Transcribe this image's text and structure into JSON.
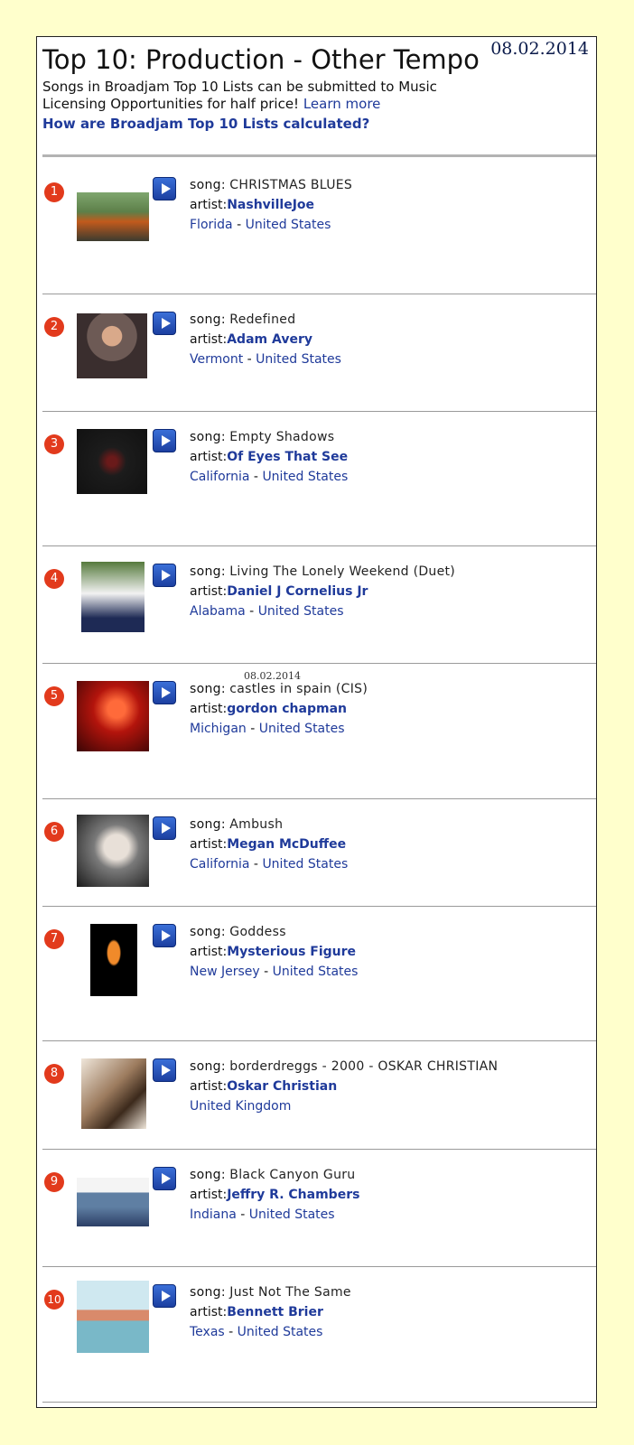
{
  "date": "08.02.2014",
  "header": {
    "title": "Top 10: Production - Other Tempo",
    "subtitle": "Songs in Broadjam Top 10 Lists can be submitted to Music Licensing Opportunities for half price!",
    "learn_more": "Learn more",
    "how_link": "How are Broadjam Top 10 Lists calculated?"
  },
  "labels": {
    "song": "song:",
    "artist": "artist:",
    "sep": " - "
  },
  "accent_color": "#e23a1c",
  "link_color": "#1f3a9a",
  "entries": [
    {
      "rank": "1",
      "song": "CHRISTMAS BLUES",
      "artist": "NashvilleJoe",
      "region": "Florida",
      "country": "United States",
      "thumb": "tractor-photo"
    },
    {
      "rank": "2",
      "song": "Redefined",
      "artist": "Adam Avery",
      "region": "Vermont",
      "country": "United States",
      "thumb": "man-portrait"
    },
    {
      "rank": "3",
      "song": "Empty Shadows",
      "artist": "Of Eyes That See",
      "region": "California",
      "country": "United States",
      "thumb": "album-cover-dark"
    },
    {
      "rank": "4",
      "song": "Living The Lonely Weekend (Duet)",
      "artist": "Daniel J Cornelius Jr",
      "region": "Alabama",
      "country": "United States",
      "thumb": "man-seated-outdoors"
    },
    {
      "rank": "5",
      "song": "castles in spain (CIS)",
      "artist": "gordon chapman",
      "region": "Michigan",
      "country": "United States",
      "thumb": "red-lit-portrait"
    },
    {
      "rank": "6",
      "song": "Ambush",
      "artist": "Megan McDuffee",
      "region": "California",
      "country": "United States",
      "thumb": "woman-headphones-bw"
    },
    {
      "rank": "7",
      "song": "Goddess",
      "artist": "Mysterious Figure",
      "region": "New Jersey",
      "country": "United States",
      "thumb": "orange-figure-black"
    },
    {
      "rank": "8",
      "song": "borderdreggs - 2000 - OSKAR CHRISTIAN",
      "artist": "Oskar Christian",
      "region": "",
      "country": "United Kingdom",
      "thumb": "man-sketch-sepia"
    },
    {
      "rank": "9",
      "song": "Black Canyon Guru",
      "artist": "Jeffry R. Chambers",
      "region": "Indiana",
      "country": "United States",
      "thumb": "man-cowboy-hat"
    },
    {
      "rank": "10",
      "song": "Just Not The Same",
      "artist": "Bennett Brier",
      "region": "Texas",
      "country": "United States",
      "thumb": "desert-cactus-art"
    }
  ]
}
